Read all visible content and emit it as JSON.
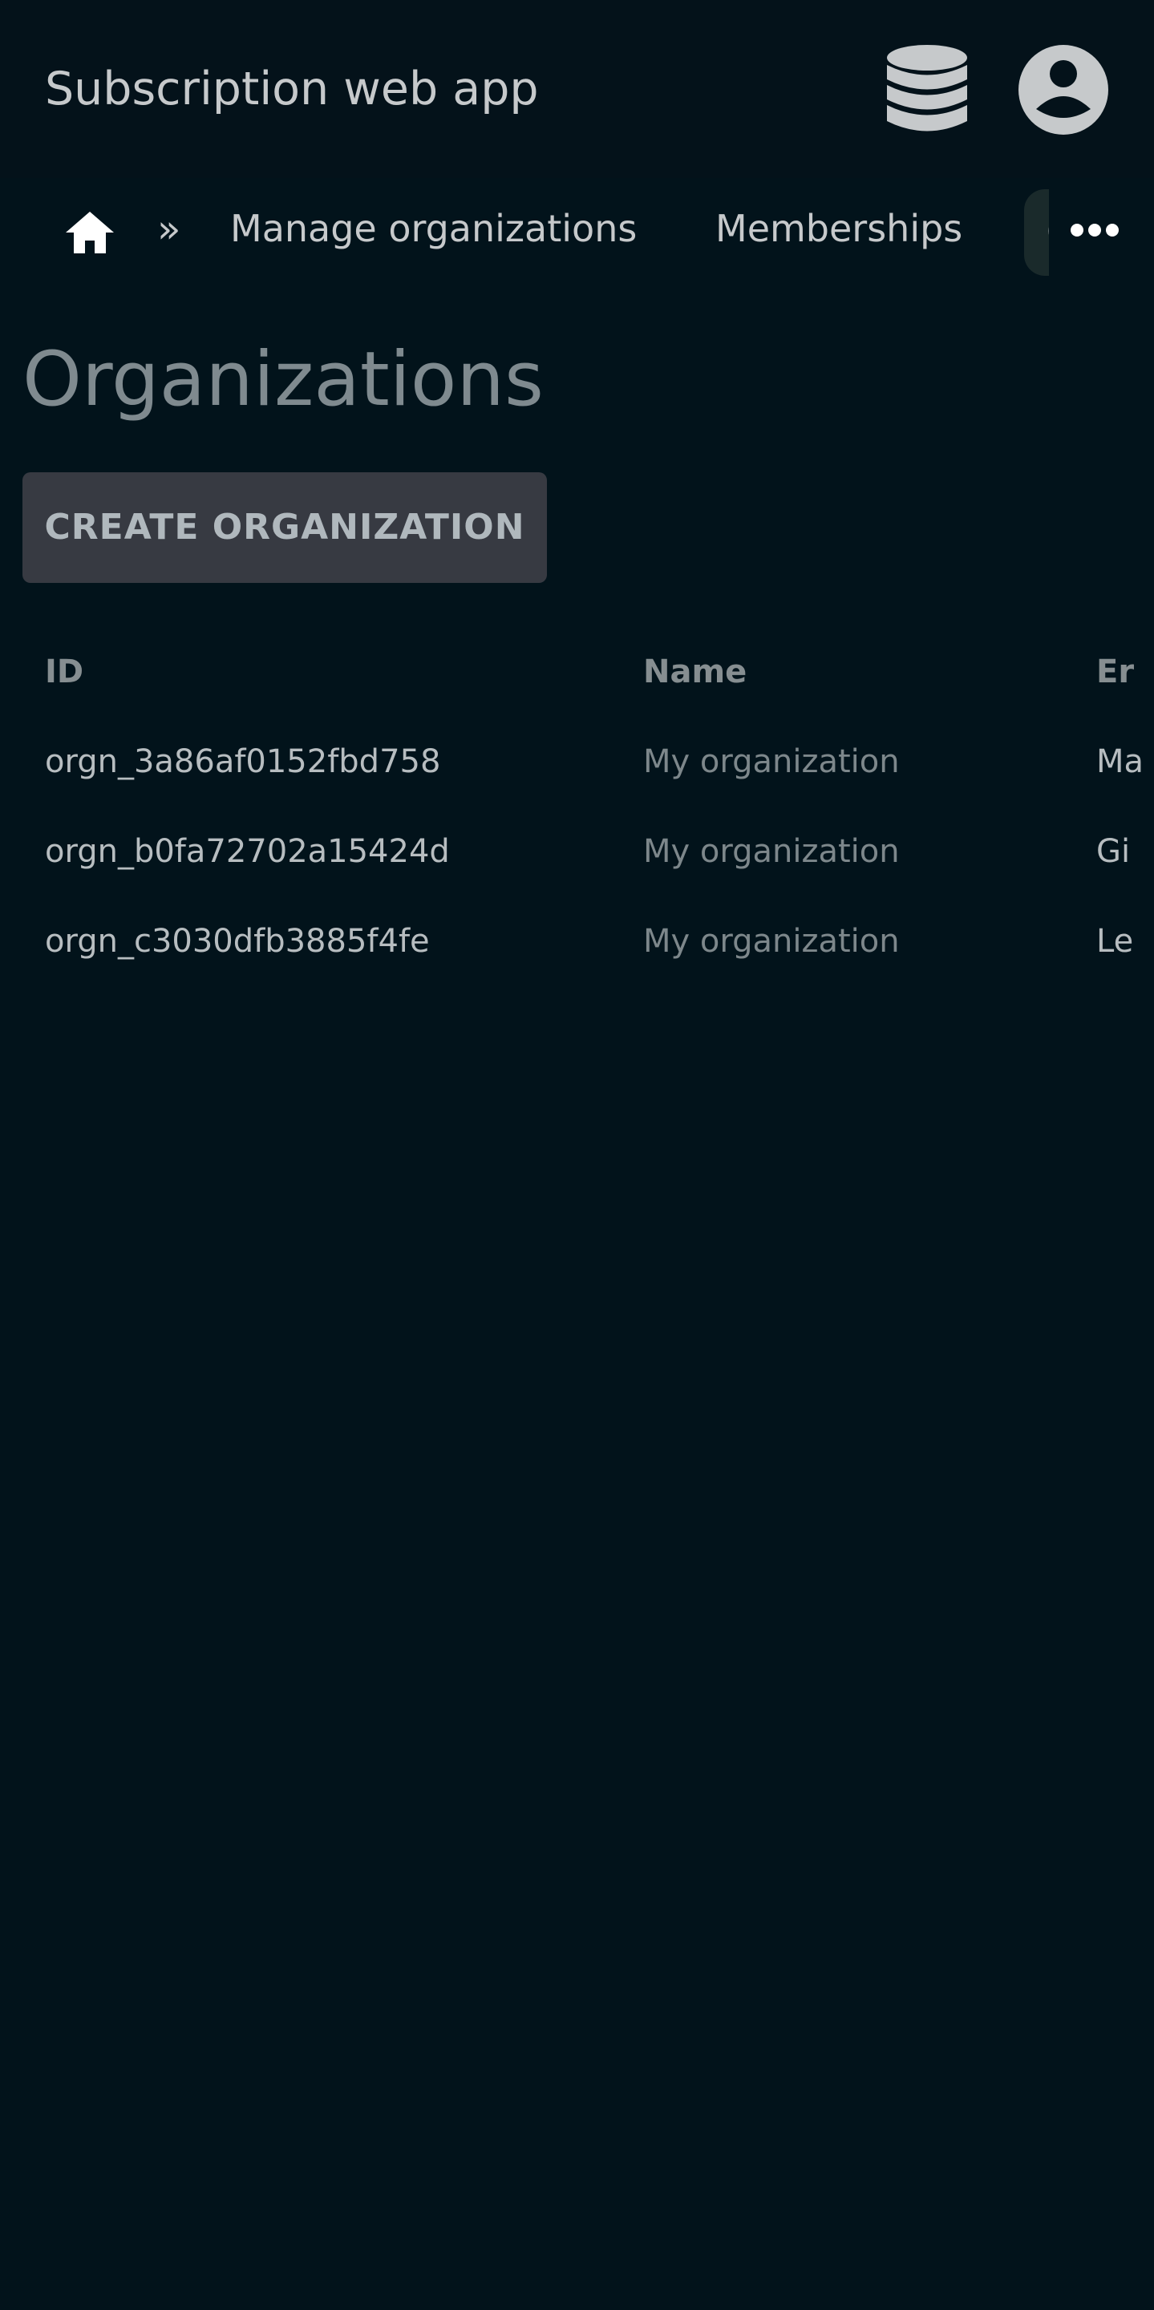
{
  "app": {
    "title": "Subscription web app",
    "icons": {
      "database": "database-icon",
      "account": "account-circle-icon"
    }
  },
  "breadcrumb": {
    "home_icon": "home-icon",
    "separator": "»",
    "items": [
      {
        "label": "Manage organizations"
      },
      {
        "label": "Memberships"
      },
      {
        "label": "O"
      }
    ],
    "more_icon": "more-horizontal-icon"
  },
  "page": {
    "title": "Organizations",
    "create_button": "CREATE ORGANIZATION"
  },
  "table": {
    "headers": {
      "id": "ID",
      "name": "Name",
      "email": "Er"
    },
    "rows": [
      {
        "id": "orgn_3a86af0152fbd758",
        "name": "My organization",
        "email": "Ma"
      },
      {
        "id": "orgn_b0fa72702a15424d",
        "name": "My organization",
        "email": "Gi"
      },
      {
        "id": "orgn_c3030dfb3885f4fe",
        "name": "My organization",
        "email": "Le"
      }
    ]
  },
  "colors": {
    "background": "#02131b",
    "text_primary": "#c6c9cb",
    "title_muted": "#7f8a8f",
    "button_bg": "#373a42",
    "active_crumb_bg": "#1a2a2b"
  }
}
